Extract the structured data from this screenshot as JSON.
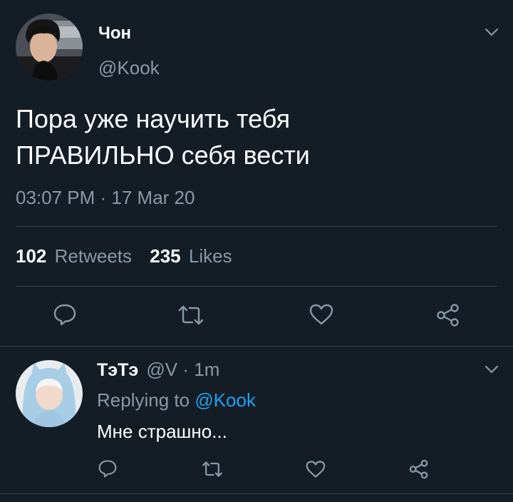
{
  "tweet": {
    "author_name": "Чон",
    "author_handle": "@Kook",
    "text_line1": "Пора уже научить тебя",
    "text_line2": "ПРАВИЛЬНО себя вести",
    "timestamp": "03:07 PM · 17 Mar 20",
    "retweets_count": "102",
    "retweets_label": "Retweets",
    "likes_count": "235",
    "likes_label": "Likes"
  },
  "reply": {
    "author_name": "ТэТэ",
    "author_handle": "@V",
    "separator": "·",
    "time": "1m",
    "replying_prefix": "Replying to",
    "replying_handle": "@Kook",
    "text": "Мне страшно..."
  },
  "colors": {
    "background": "#141d26",
    "muted": "#8899a6",
    "link": "#1da1f2",
    "divider": "#38444d"
  }
}
